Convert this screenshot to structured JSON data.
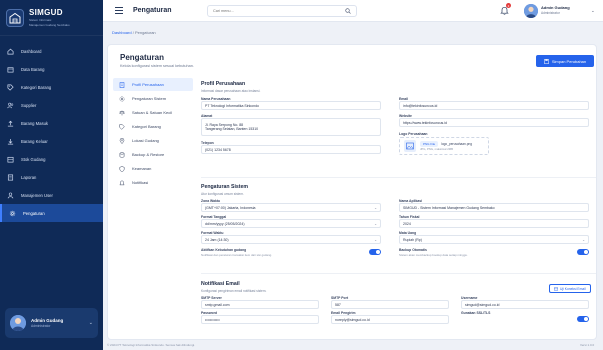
{
  "brand": {
    "name": "SIMGUD",
    "subtitle_line1": "Sistem Informasi",
    "subtitle_line2": "Manajemen Gudang Sembako"
  },
  "sidebar": {
    "items": [
      {
        "label": "Dashboard",
        "icon": "home-icon",
        "active": false
      },
      {
        "label": "Data Barang",
        "icon": "box-icon",
        "active": false
      },
      {
        "label": "Kategori Barang",
        "icon": "tag-icon",
        "active": false
      },
      {
        "label": "Supplier",
        "icon": "users-icon",
        "active": false
      },
      {
        "label": "Barang Masuk",
        "icon": "upload-icon",
        "active": false
      },
      {
        "label": "Barang Keluar",
        "icon": "download-icon",
        "active": false
      },
      {
        "label": "Stok Gudang",
        "icon": "warehouse-icon",
        "active": false
      },
      {
        "label": "Laporan",
        "icon": "report-icon",
        "active": false
      },
      {
        "label": "Manajemen User",
        "icon": "user-manage-icon",
        "active": false
      },
      {
        "label": "Pengaturan",
        "icon": "gear-icon",
        "active": true
      }
    ],
    "user": {
      "name": "Admin Gudang",
      "role": "Administrator"
    }
  },
  "topbar": {
    "title": "Pengaturan",
    "search_placeholder": "Cari menu...",
    "notif_count": "3",
    "user_name": "Admin Gudang",
    "user_role": "Administrator"
  },
  "breadcrumb": {
    "home": "Dashboard",
    "sep": "/",
    "current": "Pengaturan"
  },
  "main": {
    "title": "Pengaturan",
    "subtitle": "Kelola konfigurasi sistem sesuai kebutuhan.",
    "save_label": "Simpan Perubahan",
    "tabs": [
      {
        "label": "Profil Perusahaan",
        "icon": "building-icon",
        "active": true
      },
      {
        "label": "Pengaturan Sistem",
        "icon": "gear-icon",
        "active": false
      },
      {
        "label": "Satuan & Satuan Kecil",
        "icon": "scale-icon",
        "active": false
      },
      {
        "label": "Kategori Barang",
        "icon": "tag-icon",
        "active": false
      },
      {
        "label": "Lokasi Gudang",
        "icon": "location-icon",
        "active": false
      },
      {
        "label": "Backup & Restore",
        "icon": "database-icon",
        "active": false
      },
      {
        "label": "Keamanan",
        "icon": "shield-icon",
        "active": false
      },
      {
        "label": "Notifikasi",
        "icon": "bell-icon",
        "active": false
      }
    ]
  },
  "profil": {
    "title": "Profil Perusahaan",
    "subtitle": "Informasi dasar perusahaan atau instansi.",
    "nama_label": "Nama Perusahaan",
    "nama_value": "PT Teknologi Informatika Sinkondo",
    "email_label": "Email",
    "email_value": "info@tekinfosuncus.id",
    "alamat_label": "Alamat",
    "alamat_line1": "Jl. Raya Serpong No. 88",
    "alamat_line2": "Tangerang Selatan, Banten 15310",
    "website_label": "Website",
    "website_value": "https://www.tekinfosuncus.id",
    "telepon_label": "Telepon",
    "telepon_value": "(021) 1234 5678",
    "logo_label": "Logo Perusahaan",
    "logo_pill": "PNG File",
    "logo_file": "logo_perusahaan.png",
    "logo_hint": "JPG, PNG, maksimal 2MB"
  },
  "sistem": {
    "title": "Pengaturan Sistem",
    "subtitle": "Atur konfigurasi umum sistem.",
    "zona_label": "Zona Waktu",
    "zona_value": "(GMT+07:00) Jakarta, Indonesia",
    "nama_app_label": "Nama Aplikasi",
    "nama_app_value": "SIMGUD - Sistem Informasi Manajemen Gudang Sembako",
    "format_tgl_label": "Format Tanggal",
    "format_tgl_value": "dd/mm/yyyy (25/05/2024)",
    "tahun_label": "Tahun Fiskal",
    "tahun_value": "2024",
    "format_jam_label": "Format Waktu",
    "format_jam_value": "24 Jam (14:30)",
    "mata_uang_label": "Mata Uang",
    "mata_uang_value": "Rupiah (Rp)",
    "aktif_label": "Aktifkan Kebutuhan gudang",
    "aktif_hint": "Notifikasi dan peraturan transaksi item dari sisi gudang.",
    "backup_label": "Backup Otomatis",
    "backup_hint": "Sistem akan membackup bookup data setiap minggu."
  },
  "email": {
    "title": "Notifikasi Email",
    "subtitle": "Konfigurasi pengiriman email notifikasi sistem.",
    "test_btn": "Uji Koneksi Email",
    "smtp_host_label": "SMTP Server",
    "smtp_host_value": "smtp.gmail.com",
    "smtp_port_label": "SMTP Port",
    "smtp_port_value": "587",
    "username_label": "Username",
    "username_value": "simgud@simgud.co.id",
    "password_label": "Password",
    "password_value": "••••••••••••",
    "pengirim_label": "Email Pengirim",
    "pengirim_value": "noreply@simgud.co.id",
    "ssl_label": "Gunakan SSL/TLS"
  },
  "footer": {
    "left": "© 2024 PT Teknologi Informatika Sinkondo. Semua hak dilindungi.",
    "right": "Versi 1.0.0"
  },
  "colors": {
    "sidebar": "#0f2a57",
    "accent": "#2563eb",
    "background": "#eef1f7"
  }
}
